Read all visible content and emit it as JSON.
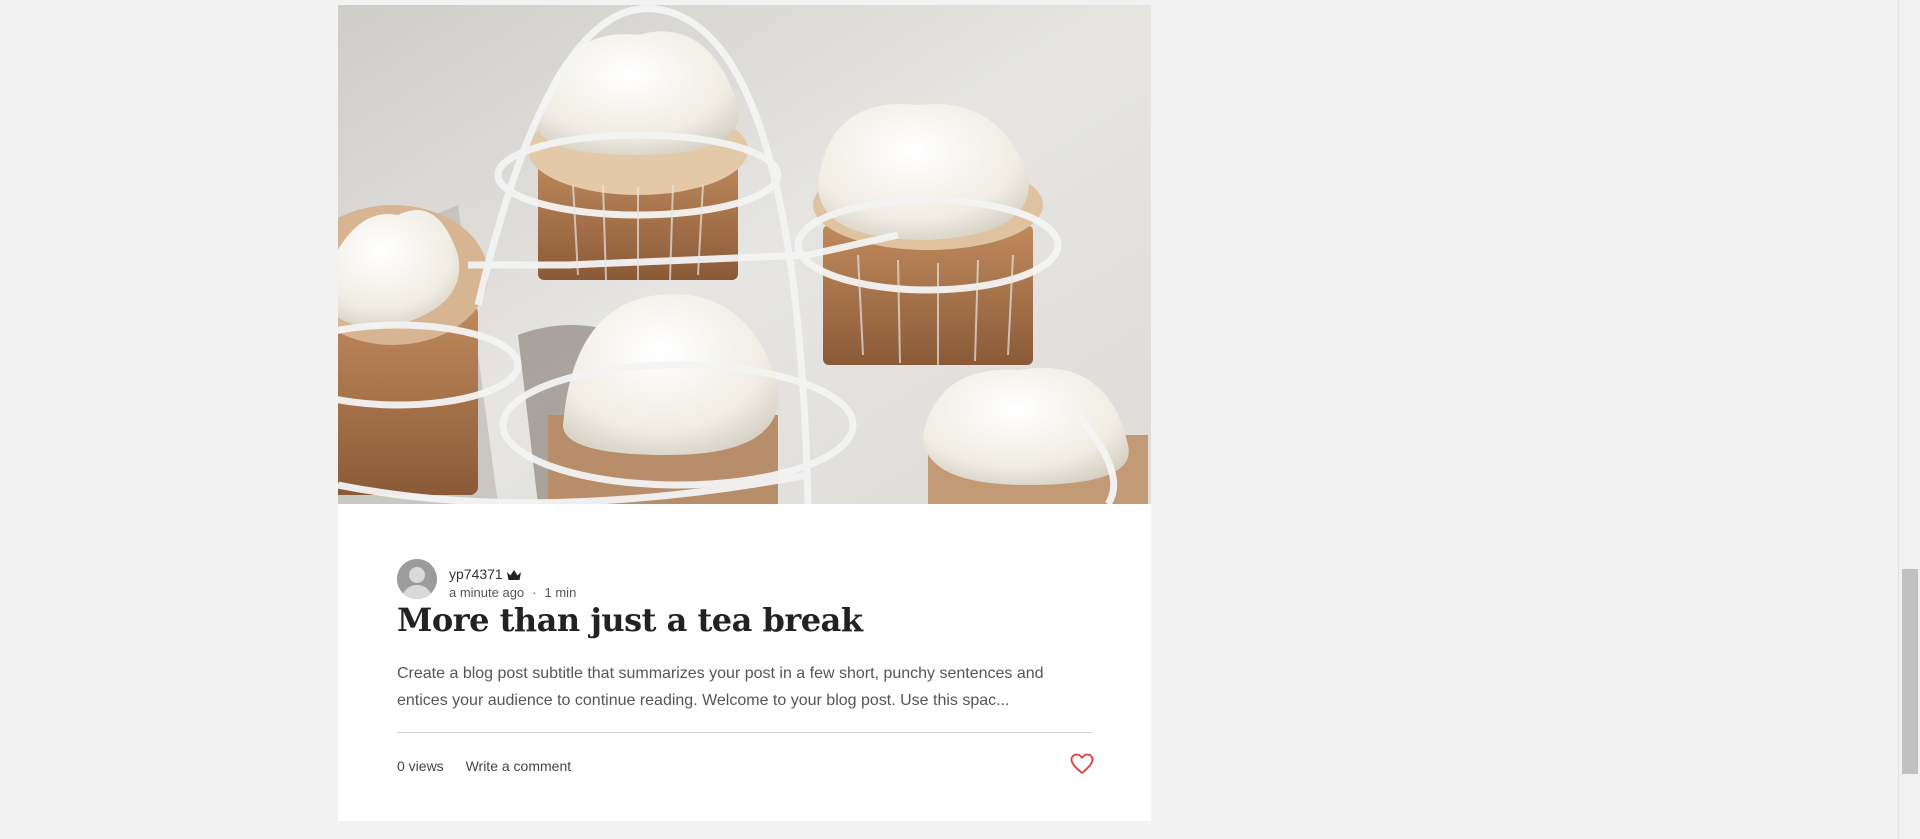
{
  "post": {
    "author": "yp74371",
    "author_badge_icon": "crown-icon",
    "published": "a minute ago",
    "separator": "·",
    "read_time": "1 min",
    "title": "More than just a tea break",
    "excerpt": "Create a blog post subtitle that summarizes your post in a few short, punchy sentences and entices your audience to continue reading. Welcome to your blog post. Use this spac...",
    "views": "0 views",
    "comment_label": "Write a comment",
    "like_icon": "heart-icon"
  },
  "colors": {
    "page_background": "#f2f2f2",
    "card_background": "#ffffff",
    "like_heart": "#e43b3b",
    "title_text": "#222222"
  }
}
